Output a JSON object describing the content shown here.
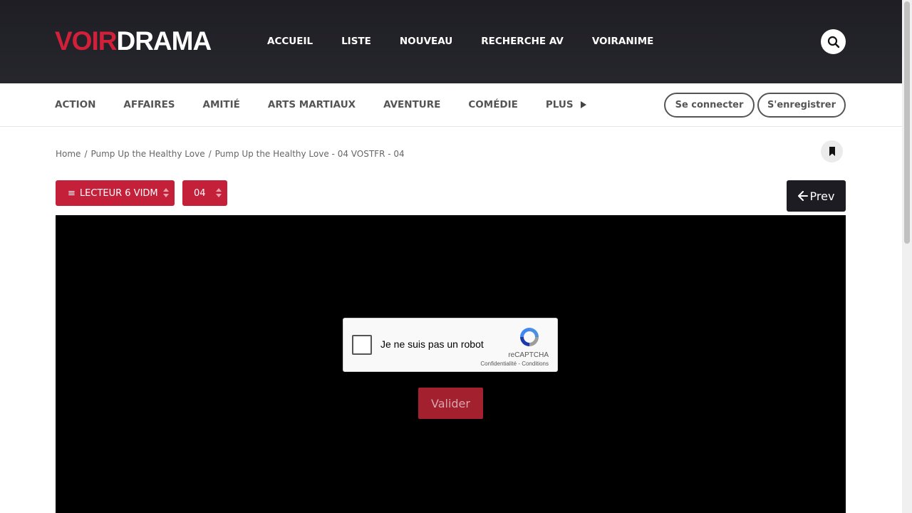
{
  "brand": {
    "part1": "VOIR",
    "part2": "DRAMA"
  },
  "main_nav": [
    "ACCUEIL",
    "LISTE",
    "NOUVEAU",
    "RECHERCHE AV",
    "VOIRANIME"
  ],
  "genres": [
    "ACTION",
    "AFFAIRES",
    "AMITIÉ",
    "ARTS MARTIAUX",
    "AVENTURE",
    "COMÉDIE"
  ],
  "genres_more_label": "PLUS",
  "auth": {
    "login_label": "Se connecter",
    "register_label": "S'enregistrer"
  },
  "breadcrumb": [
    "Home",
    "Pump Up the Healthy Love",
    "Pump Up the Healthy Love - 04 VOSTFR - 04"
  ],
  "player_select": {
    "icon": "≡",
    "label": "LECTEUR 6 VIDM"
  },
  "episode_select": {
    "value": "04"
  },
  "prev_label": "Prev",
  "recaptcha": {
    "label": "Je ne suis pas un robot",
    "brand": "reCAPTCHA",
    "terms": "Confidentialité - Conditions"
  },
  "validate_label": "Valider",
  "colors": {
    "accent": "#c5203a",
    "header_bg": "#1e1e24",
    "player_bg": "#000000"
  },
  "icons": {
    "search": "search-icon",
    "bookmark": "bookmark-icon",
    "prev": "arrow-left-icon",
    "more": "triangle-right-icon"
  }
}
